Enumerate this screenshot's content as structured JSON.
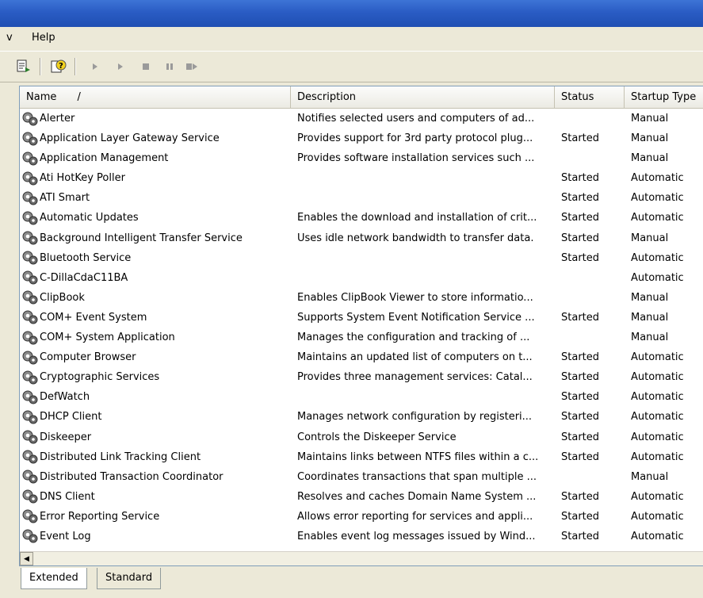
{
  "menu": {
    "view_fragment": "v",
    "help": "Help"
  },
  "toolbar": {
    "icons": [
      "export-list-icon",
      "help-icon",
      "start-service-icon",
      "start-icon",
      "stop-icon",
      "pause-icon",
      "resume-icon"
    ]
  },
  "columns": {
    "name": "Name",
    "sort_indicator": "/",
    "description": "Description",
    "status": "Status",
    "startup_type": "Startup Type"
  },
  "services": [
    {
      "name": "Alerter",
      "description": "Notifies selected users and computers of ad...",
      "status": "",
      "startup": "Manual"
    },
    {
      "name": "Application Layer Gateway Service",
      "description": "Provides support for 3rd party protocol plug...",
      "status": "Started",
      "startup": "Manual"
    },
    {
      "name": "Application Management",
      "description": "Provides software installation services such ...",
      "status": "",
      "startup": "Manual"
    },
    {
      "name": "Ati HotKey Poller",
      "description": "",
      "status": "Started",
      "startup": "Automatic"
    },
    {
      "name": "ATI Smart",
      "description": "",
      "status": "Started",
      "startup": "Automatic"
    },
    {
      "name": "Automatic Updates",
      "description": "Enables the download and installation of crit...",
      "status": "Started",
      "startup": "Automatic"
    },
    {
      "name": "Background Intelligent Transfer Service",
      "description": "Uses idle network bandwidth to transfer data.",
      "status": "Started",
      "startup": "Manual"
    },
    {
      "name": "Bluetooth Service",
      "description": "",
      "status": "Started",
      "startup": "Automatic"
    },
    {
      "name": "C-DillaCdaC11BA",
      "description": "",
      "status": "",
      "startup": "Automatic"
    },
    {
      "name": "ClipBook",
      "description": "Enables ClipBook Viewer to store informatio...",
      "status": "",
      "startup": "Manual"
    },
    {
      "name": "COM+ Event System",
      "description": "Supports System Event Notification Service ...",
      "status": "Started",
      "startup": "Manual"
    },
    {
      "name": "COM+ System Application",
      "description": "Manages the configuration and tracking of ...",
      "status": "",
      "startup": "Manual"
    },
    {
      "name": "Computer Browser",
      "description": "Maintains an updated list of computers on t...",
      "status": "Started",
      "startup": "Automatic"
    },
    {
      "name": "Cryptographic Services",
      "description": "Provides three management services: Catal...",
      "status": "Started",
      "startup": "Automatic"
    },
    {
      "name": "DefWatch",
      "description": "",
      "status": "Started",
      "startup": "Automatic"
    },
    {
      "name": "DHCP Client",
      "description": "Manages network configuration by registeri...",
      "status": "Started",
      "startup": "Automatic"
    },
    {
      "name": "Diskeeper",
      "description": "Controls the Diskeeper Service",
      "status": "Started",
      "startup": "Automatic"
    },
    {
      "name": "Distributed Link Tracking Client",
      "description": "Maintains links between NTFS files within a c...",
      "status": "Started",
      "startup": "Automatic"
    },
    {
      "name": "Distributed Transaction Coordinator",
      "description": "Coordinates transactions that span multiple ...",
      "status": "",
      "startup": "Manual"
    },
    {
      "name": "DNS Client",
      "description": "Resolves and caches Domain Name System ...",
      "status": "Started",
      "startup": "Automatic"
    },
    {
      "name": "Error Reporting Service",
      "description": "Allows error reporting for services and appli...",
      "status": "Started",
      "startup": "Automatic"
    },
    {
      "name": "Event Log",
      "description": "Enables event log messages issued by Wind...",
      "status": "Started",
      "startup": "Automatic"
    }
  ],
  "tabs": {
    "extended": "Extended",
    "standard": "Standard"
  }
}
